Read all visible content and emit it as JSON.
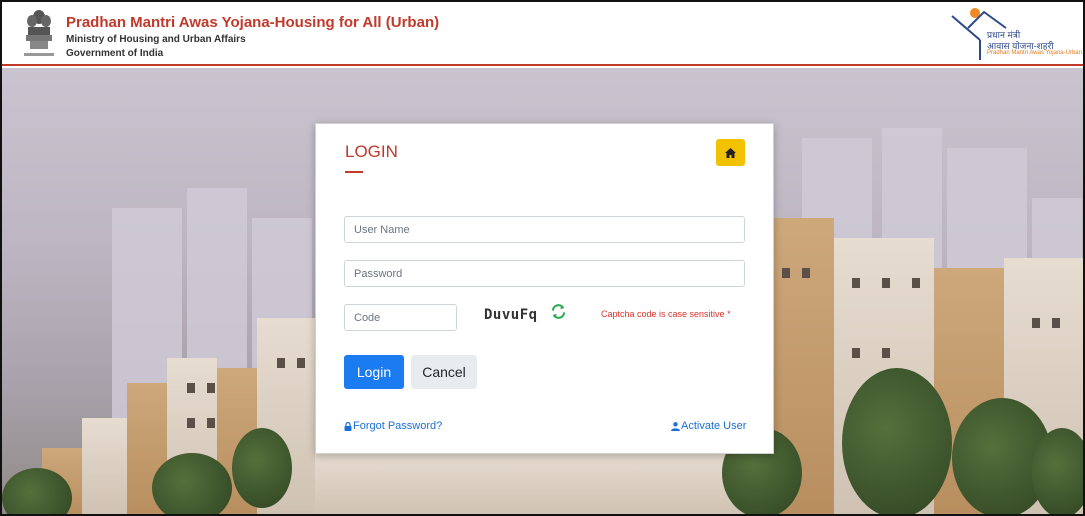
{
  "header": {
    "title": "Pradhan Mantri Awas Yojana-Housing for All (Urban)",
    "ministry": "Ministry of Housing and Urban Affairs",
    "government": "Government of India",
    "emblem_icon": "national-emblem-icon",
    "logo_icon": "pmay-logo-icon",
    "logo_line1": "प्रधान मंत्री",
    "logo_line2": "आवास योजना-शहरी",
    "logo_line3": "Pradhan Mantri Awas Yojana-Urban"
  },
  "login": {
    "title": "LOGIN",
    "home_icon": "home-icon",
    "username_placeholder": "User Name",
    "password_placeholder": "Password",
    "code_placeholder": "Code",
    "captcha_text": "DuvuFq",
    "refresh_icon": "refresh-icon",
    "captcha_note": "Captcha code is case sensitive *",
    "login_label": "Login",
    "cancel_label": "Cancel",
    "forgot_label": "Forgot Password?",
    "forgot_icon": "lock-icon",
    "activate_label": "Activate User",
    "activate_icon": "user-icon"
  },
  "colors": {
    "brand_red": "#c0392b",
    "primary_blue": "#1a7cf0",
    "home_yellow": "#f2c200",
    "link_blue": "#1a6fd8",
    "note_red": "#d9352b"
  }
}
